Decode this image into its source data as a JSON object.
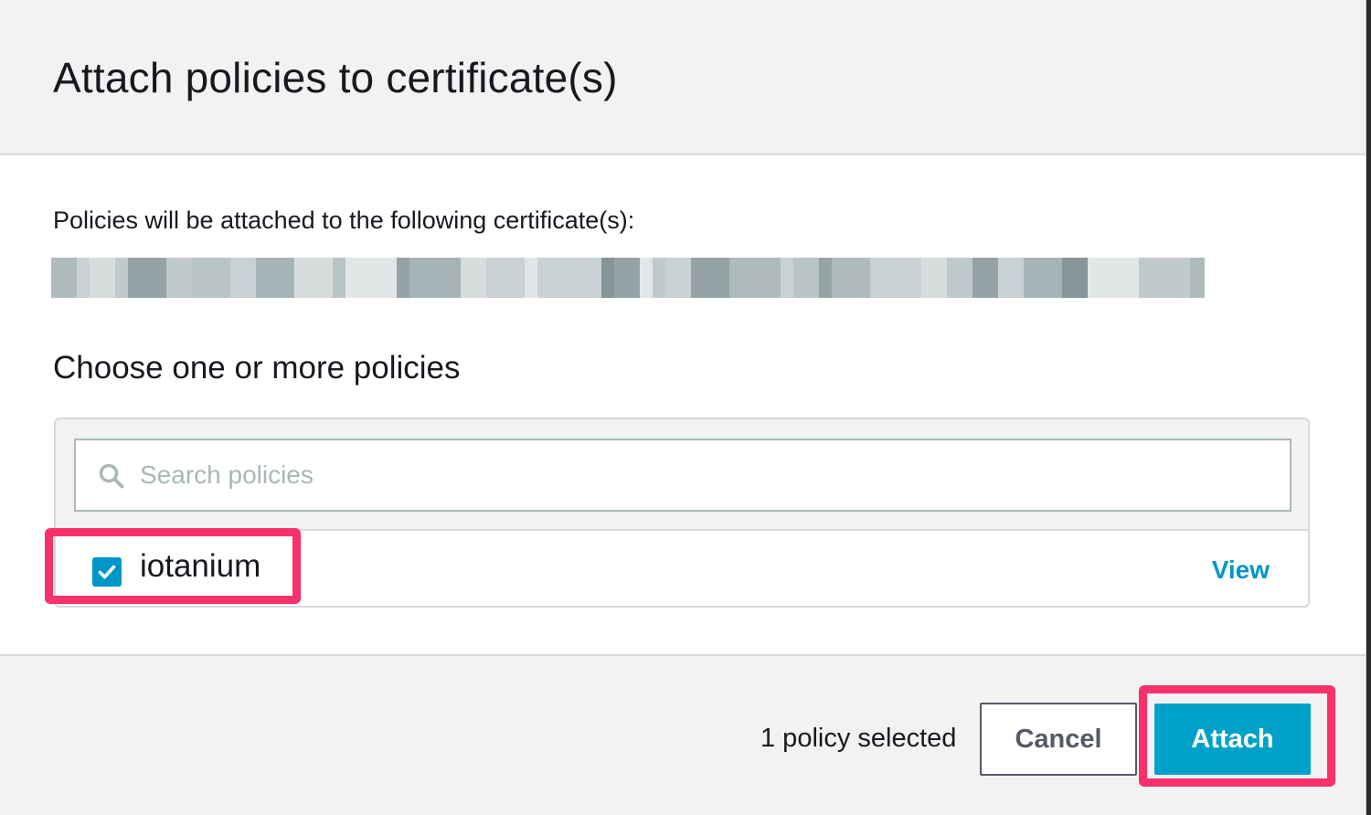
{
  "modal": {
    "title": "Attach policies to certificate(s)"
  },
  "certificates": {
    "intro": "Policies will be attached to the following certificate(s):",
    "value_redacted": true
  },
  "policies": {
    "heading": "Choose one or more policies",
    "search": {
      "placeholder": "Search policies",
      "value": "",
      "icon": "search-icon"
    },
    "items": [
      {
        "name": "iotanium",
        "checked": true,
        "view_label": "View"
      }
    ]
  },
  "footer": {
    "selection_status": "1 policy selected",
    "cancel_label": "Cancel",
    "attach_label": "Attach"
  },
  "colors": {
    "header_bg": "#f2f2f2",
    "accent": "#00a1c9",
    "link": "#0096c7",
    "checkbox": "#0095c8",
    "highlight": "#f7316b",
    "text": "#16191f",
    "border": "#d5dbdb"
  }
}
